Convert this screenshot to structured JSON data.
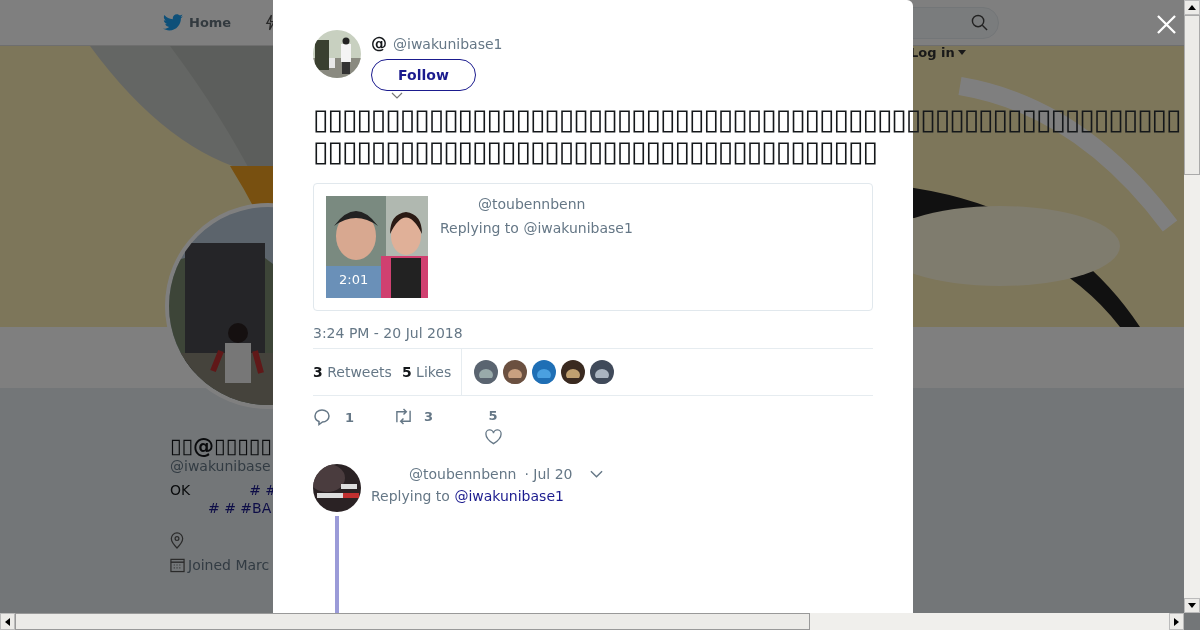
{
  "top_nav": {
    "home": "Home",
    "login": "Log in"
  },
  "profile": {
    "name": "▯▯@▯▯▯▯▯",
    "handle": "@iwakunibase",
    "bio_text": "OK",
    "bio_tags": [
      "# #",
      "# # #BA"
    ],
    "joined": "Joined Marc"
  },
  "tweet": {
    "author_at": "@",
    "handle": "@iwakunibase1",
    "follow": "Follow",
    "text": "▯▯▯▯▯▯▯▯▯▯▯▯▯▯▯▯▯▯▯▯▯▯▯▯▯▯▯▯▯▯▯▯▯▯▯▯▯▯▯▯▯▯▯▯▯▯▯▯▯▯▯▯▯▯▯▯▯▯▯▯▯▯▯▯▯▯▯▯▯▯▯▯▯▯▯▯▯▯▯▯▯▯▯▯▯▯▯▯▯▯▯▯▯▯▯▯▯▯▯",
    "quoted": {
      "handle": "@toubennbenn",
      "replying": "Replying to @iwakunibase1",
      "duration": "2:01"
    },
    "timestamp": "3:24 PM - 20 Jul 2018",
    "stats": [
      {
        "count": "3",
        "label": "Retweets"
      },
      {
        "count": "5",
        "label": "Likes"
      }
    ],
    "actions": [
      {
        "kind": "reply",
        "count": "1"
      },
      {
        "kind": "retweet",
        "count": "3"
      },
      {
        "kind": "like",
        "count": "5"
      }
    ]
  },
  "reply": {
    "handle": "@toubennbenn",
    "date": "· Jul 20",
    "replying_prefix": "Replying to",
    "replying_link": "@iwakunibase1"
  }
}
